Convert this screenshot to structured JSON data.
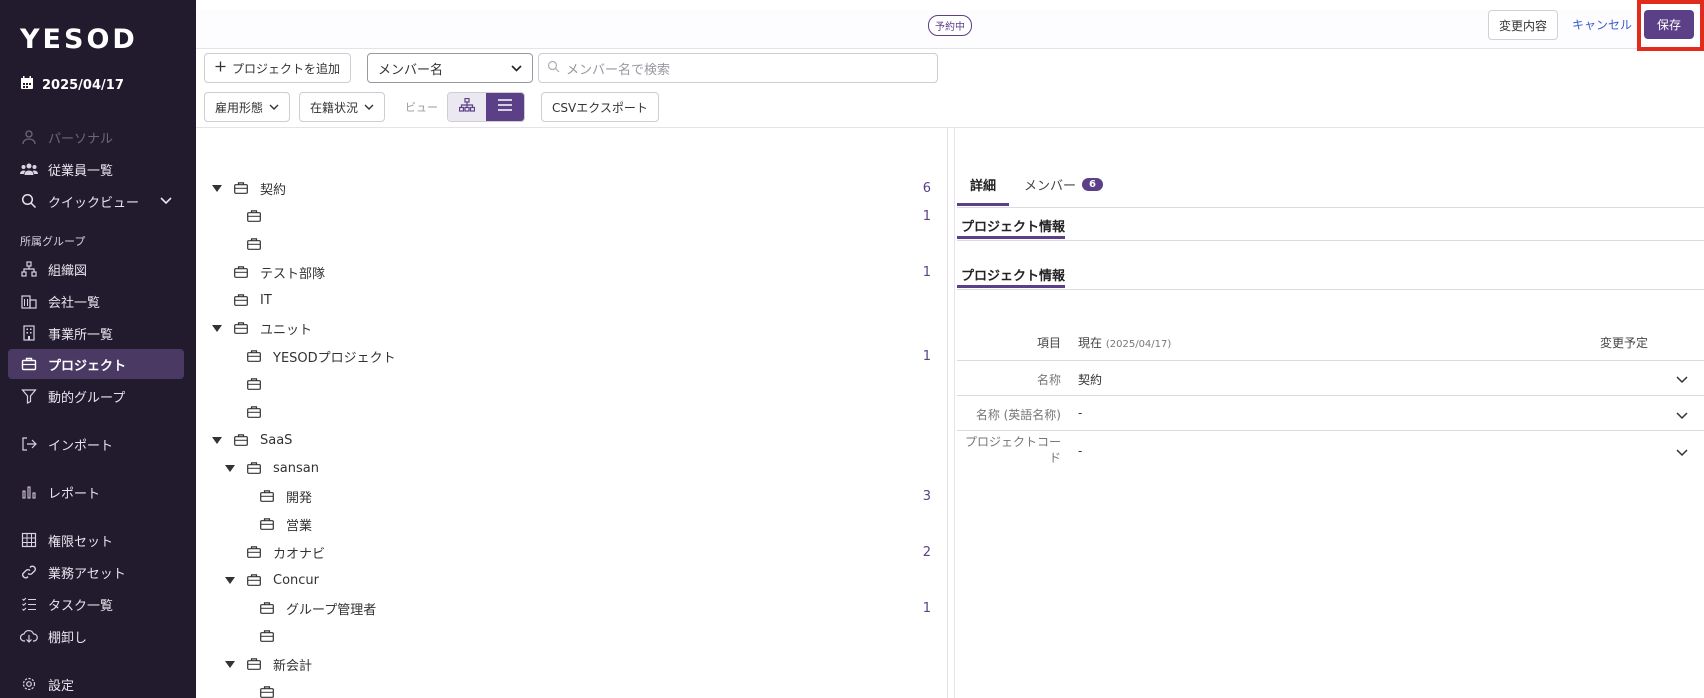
{
  "app": {
    "logo": "YESOD",
    "date": "2025/04/17"
  },
  "sidebar": {
    "items": [
      {
        "label": "パーソナル",
        "icon": "user-icon"
      },
      {
        "label": "従業員一覧",
        "icon": "people-icon"
      },
      {
        "label": "クイックビュー",
        "icon": "search-icon"
      }
    ],
    "section": "所属グループ",
    "group_items": [
      {
        "label": "組織図",
        "icon": "org-chart-icon"
      },
      {
        "label": "会社一覧",
        "icon": "company-icon"
      },
      {
        "label": "事業所一覧",
        "icon": "building-icon"
      },
      {
        "label": "プロジェクト",
        "icon": "briefcase-icon"
      },
      {
        "label": "動的グループ",
        "icon": "filter-icon"
      }
    ],
    "bottom_items": [
      {
        "label": "インポート",
        "icon": "import-icon"
      },
      {
        "label": "レポート",
        "icon": "chart-icon"
      },
      {
        "label": "権限セット",
        "icon": "grid-icon"
      },
      {
        "label": "業務アセット",
        "icon": "link-icon"
      },
      {
        "label": "タスク一覧",
        "icon": "tasklist-icon"
      },
      {
        "label": "棚卸し",
        "icon": "cloud-download-icon"
      },
      {
        "label": "設定",
        "icon": "gear-icon"
      }
    ]
  },
  "topbar": {
    "status_badge": "予約中",
    "changes_label": "変更内容",
    "cancel_label": "キャンセル",
    "save_label": "保存"
  },
  "toolbar": {
    "add_project": "プロジェクトを追加",
    "member_select": "メンバー名",
    "search_placeholder": "メンバー名で検索",
    "employment_filter": "雇用形態",
    "status_filter": "在籍状況",
    "view_label": "ビュー",
    "csv_export": "CSVエクスポート"
  },
  "tree": [
    {
      "label": "契約",
      "count": "6",
      "depth": 0,
      "caret": true
    },
    {
      "label": "",
      "count": "1",
      "depth": 1,
      "caret": false
    },
    {
      "label": "",
      "count": "",
      "depth": 1,
      "caret": false
    },
    {
      "label": "テスト部隊",
      "count": "1",
      "depth": 0,
      "caret": false
    },
    {
      "label": "IT",
      "count": "",
      "depth": 0,
      "caret": false
    },
    {
      "label": "ユニット",
      "count": "",
      "depth": 0,
      "caret": true
    },
    {
      "label": "YESODプロジェクト",
      "count": "1",
      "depth": 1,
      "caret": false
    },
    {
      "label": "",
      "count": "",
      "depth": 1,
      "caret": false
    },
    {
      "label": "",
      "count": "",
      "depth": 1,
      "caret": false
    },
    {
      "label": "SaaS",
      "count": "",
      "depth": 0,
      "caret": true
    },
    {
      "label": "sansan",
      "count": "",
      "depth": 1,
      "caret": true
    },
    {
      "label": "開発",
      "count": "3",
      "depth": 2,
      "caret": false
    },
    {
      "label": "営業",
      "count": "",
      "depth": 2,
      "caret": false
    },
    {
      "label": "カオナビ",
      "count": "2",
      "depth": 1,
      "caret": false
    },
    {
      "label": "Concur",
      "count": "",
      "depth": 1,
      "caret": true
    },
    {
      "label": "グループ管理者",
      "count": "1",
      "depth": 2,
      "caret": false
    },
    {
      "label": "",
      "count": "",
      "depth": 2,
      "caret": false
    },
    {
      "label": "新会計",
      "count": "",
      "depth": 1,
      "caret": true
    },
    {
      "label": "",
      "count": "",
      "depth": 2,
      "caret": false
    }
  ],
  "detail": {
    "tab_detail": "詳細",
    "tab_members": "メンバー",
    "members_count": "6",
    "section1": "プロジェクト情報",
    "section2": "プロジェクト情報",
    "col_item": "項目",
    "col_current": "現在",
    "col_current_date": "(2025/04/17)",
    "col_planned": "変更予定",
    "rows": [
      {
        "label": "名称",
        "value": "契約"
      },
      {
        "label": "名称 (英語名称)",
        "value": "-"
      },
      {
        "label": "プロジェクトコード",
        "value": "-"
      }
    ]
  },
  "colors": {
    "sidebar_bg": "#221a2d",
    "accent": "#5b3f87",
    "highlight": "#e12b1d"
  }
}
